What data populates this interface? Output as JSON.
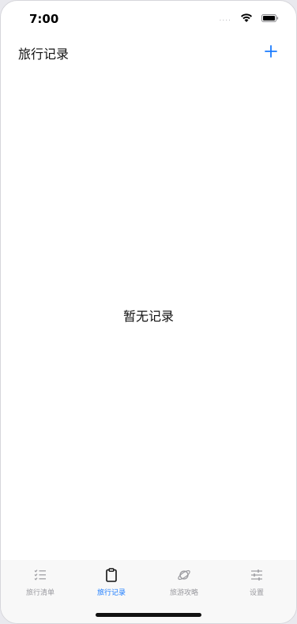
{
  "status_bar": {
    "time": "7:00",
    "signal": "....",
    "wifi_icon": "wifi-icon",
    "battery_icon": "battery-icon"
  },
  "nav": {
    "title": "旅行记录",
    "add_icon": "plus-icon",
    "accent_color": "#1a7bff"
  },
  "main": {
    "empty_text": "暂无记录"
  },
  "tab_bar": {
    "tabs": [
      {
        "label": "旅行清单",
        "icon": "checklist-icon",
        "active": false
      },
      {
        "label": "旅行记录",
        "icon": "clipboard-icon",
        "active": true
      },
      {
        "label": "旅游攻略",
        "icon": "planet-icon",
        "active": false
      },
      {
        "label": "设置",
        "icon": "sliders-icon",
        "active": false
      }
    ]
  }
}
